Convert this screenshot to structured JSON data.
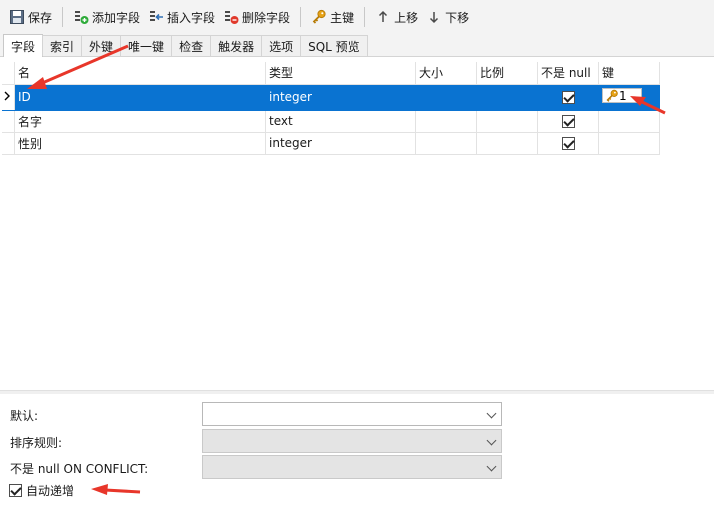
{
  "toolbar": {
    "save": "保存",
    "add_field": "添加字段",
    "insert_field": "插入字段",
    "delete_field": "删除字段",
    "primary_key": "主键",
    "move_up": "上移",
    "move_down": "下移"
  },
  "tabs": [
    "字段",
    "索引",
    "外键",
    "唯一键",
    "检查",
    "触发器",
    "选项",
    "SQL 预览"
  ],
  "active_tab": "字段",
  "columns": [
    "名",
    "类型",
    "大小",
    "比例",
    "不是 null",
    "键"
  ],
  "rows": [
    {
      "name": "ID",
      "type": "integer",
      "size": "",
      "scale": "",
      "not_null": true,
      "key": "1",
      "selected": true
    },
    {
      "name": "名字",
      "type": "text",
      "size": "",
      "scale": "",
      "not_null": true,
      "key": "",
      "selected": false
    },
    {
      "name": "性别",
      "type": "integer",
      "size": "",
      "scale": "",
      "not_null": true,
      "key": "",
      "selected": false
    }
  ],
  "properties": {
    "default_label": "默认:",
    "default_value": "",
    "collation_label": "排序规则:",
    "collation_value": "",
    "on_conflict_label": "不是 null ON CONFLICT:",
    "on_conflict_value": "",
    "auto_increment_label": "自动递增",
    "auto_increment_checked": true
  },
  "colors": {
    "selection": "#0a73d1",
    "annotation_arrow": "#e8362a",
    "key_icon": "#e8a317"
  },
  "icons": {
    "save": "save-disk-icon",
    "add_field": "add-field-icon",
    "insert_field": "insert-field-icon",
    "delete_field": "delete-field-icon",
    "primary_key": "key-icon",
    "move_up": "arrow-up-icon",
    "move_down": "arrow-down-icon"
  }
}
